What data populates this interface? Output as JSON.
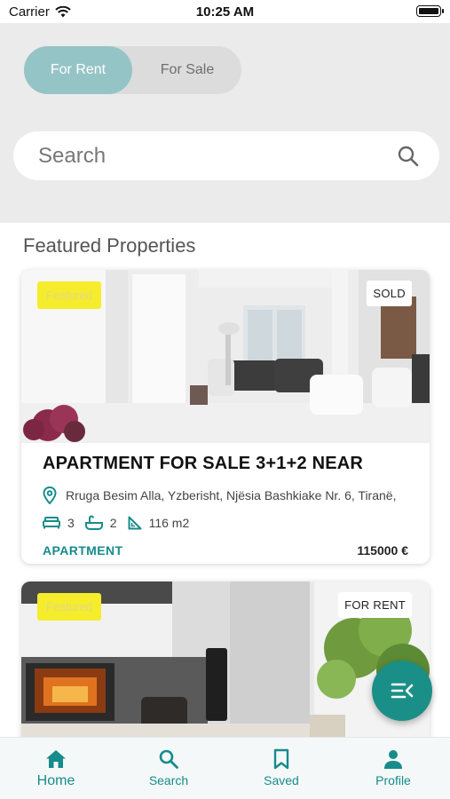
{
  "status_bar": {
    "carrier": "Carrier",
    "time": "10:25 AM"
  },
  "toggle": {
    "for_rent": "For Rent",
    "for_sale": "For Sale",
    "selected": "For Rent"
  },
  "search": {
    "placeholder": "Search"
  },
  "section_title": "Featured Properties",
  "listings": [
    {
      "featured_label": "Featured",
      "status": "SOLD",
      "title": "APARTMENT FOR SALE 3+1+2 NEAR",
      "address": "Rruga Besim Alla, Yzberisht, Njësia Bashkiake Nr. 6, Tiranë,",
      "bedrooms": "3",
      "bathrooms": "2",
      "area": "116 m2",
      "type": "APARTMENT",
      "price": "115000 €"
    },
    {
      "featured_label": "Featured",
      "status": "FOR RENT"
    }
  ],
  "bottom_nav": [
    {
      "label": "Home",
      "icon": "home-icon",
      "active": true
    },
    {
      "label": "Search",
      "icon": "search-icon",
      "active": false
    },
    {
      "label": "Saved",
      "icon": "bookmark-icon",
      "active": false
    },
    {
      "label": "Profile",
      "icon": "person-icon",
      "active": false
    }
  ],
  "colors": {
    "accent": "#168c8c",
    "toggle_active": "#95c4c6",
    "featured_badge": "#f5ec2b",
    "fab": "#1a8f88"
  }
}
